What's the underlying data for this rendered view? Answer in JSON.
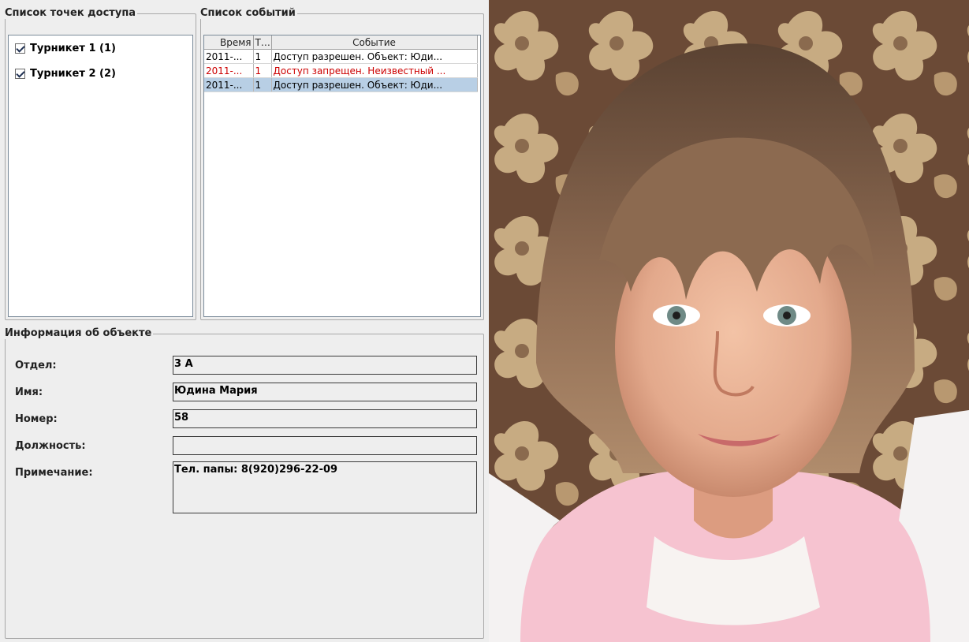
{
  "access_points": {
    "title": "Список точек доступа",
    "items": [
      {
        "label": "Турникет 1 (1)",
        "checked": true
      },
      {
        "label": "Турникет 2 (2)",
        "checked": true
      }
    ]
  },
  "events": {
    "title": "Список событий",
    "columns": [
      "Время",
      "Т...",
      "Событие"
    ],
    "rows": [
      {
        "time": "2011-...",
        "type": "1",
        "event": "Доступ разрешен. Объект: Юди...",
        "status": "granted"
      },
      {
        "time": "2011-...",
        "type": "1",
        "event": "Доступ запрещен. Неизвестный ...",
        "status": "denied"
      },
      {
        "time": "2011-...",
        "type": "1",
        "event": "Доступ разрешен. Объект: Юди...",
        "status": "granted-selected"
      }
    ]
  },
  "object_info": {
    "title": "Информация об объекте",
    "fields": [
      {
        "label": "Отдел:",
        "value": "3 А"
      },
      {
        "label": "Имя:",
        "value": "Юдина Мария"
      },
      {
        "label": "Номер:",
        "value": "58"
      },
      {
        "label": "Должность:",
        "value": ""
      },
      {
        "label": "Примечание:",
        "value": "Тел. папы: 8(920)296-22-09"
      }
    ]
  },
  "colors": {
    "denied_text": "#cc0000",
    "selected_row": "#b8cfe5",
    "panel_bg": "#eeeeee"
  }
}
